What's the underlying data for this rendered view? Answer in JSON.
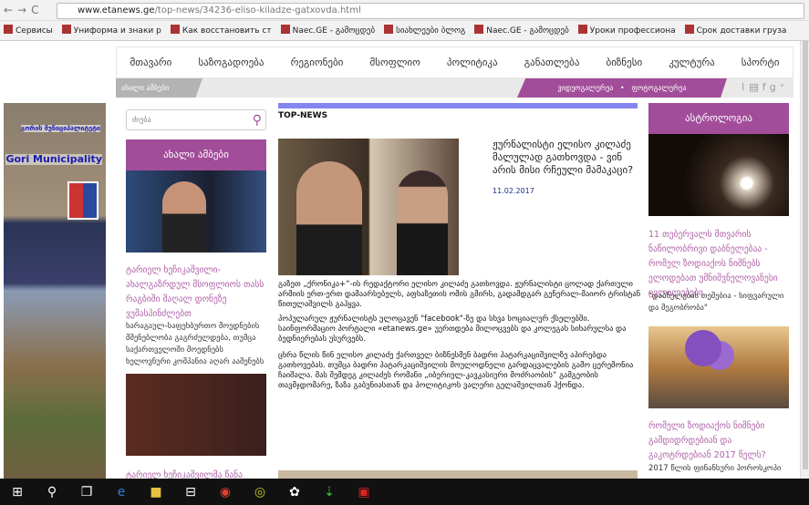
{
  "browser": {
    "url_domain": "www.etanews.ge",
    "url_path": "/top-news/34236-eliso-kiladze-gatxovda.html",
    "bookmarks": [
      "Сервисы",
      "Униформа и знаки р",
      "Как восстановить ст",
      "Naec.GE - გამოცდებ",
      "სიახლეები ბლოგ",
      "Naec.GE - გამოცდებ",
      "Уроки профессиона",
      "Срок доставки груза"
    ]
  },
  "nav": {
    "items": [
      "მთავარი",
      "საზოგადოება",
      "რეგიონები",
      "მსოფლიო",
      "პოლიტიკა",
      "განათლება",
      "ბიზნესი",
      "კულტურა",
      "სპორტი"
    ]
  },
  "subnav": {
    "latest": "ახალი ამბები",
    "video": "ვიდეოგალერეა",
    "dot": "•",
    "photo": "ფოტოგალერეა"
  },
  "banner": {
    "ka": "გორის მუნიციპალიტეტი",
    "en": "Gori Municipality"
  },
  "search": {
    "placeholder": "ძიება"
  },
  "left": {
    "heading": "ახალი ამბები",
    "item1_title": "ტარიელ ხეჩიკაშვილი- ახალგაზრდულ მსოფლიოს თასს რაგბიში მაღალ დონეზე ვუმასპინძლებთ",
    "item1_text": "ხარაგაულ-საფეხბურთო მოედნების მშენებლობა გაგრძელდება, თუმცა საქართველოში მოედნებს ხელოვნური კომპანია აღარ ააშენებს",
    "item2_title": "ტარიელ ხეჩიკაშვილმა წანა"
  },
  "main": {
    "section": "TOP-NEWS",
    "headline": "ჟურნალისტი ელისო კილაძე მალულად გათხოვდა - ვინ არის მისი რჩეული მამაკაცი?",
    "date": "11.02.2017",
    "p1": "გაზეთ „ქრონიკა+“-ის რედაქტორი ელისო კილაძე გათხოვდა. ჟურნალისტი ცოლად ქართული არმიის ერთ-ერთ დამაარსებელს, აფხაზეთის ომის გმირს, გადამდგარ გენერალ-მაიორ ტრისტან წითელაშვილს გაჰყვა.",
    "p2": "პოპულარულ ჟურნალისტს ულოცავენ \"facebook\"-ზე და სხვა სოციალურ ქსელებში. საინფორმაციო პორტალი «etanews.ge» უერთდება მილოცვებს და კოლეგას სიხარულსა და ბედნიერებას უსურვებს.",
    "p3": "ცხრა წლის წინ ელისო კილაძე ქართველ ბიზნესმენ ბადრი პატარკაციშვილზე აპირებდა გათხოვებას. თუმცა ბადრი პატარკაციშვილის მოულოდნელი გარდაცვალების გამო ცერემონია ჩაიშალა. მას შემდეგ კილაძეს რომანი „იბერიულ-კავკასიური მოძრაობის“ გამგეობის თავმჯდომარე, ზაზა გაბუნიასთან და პოლიტიკოს ვალერი გელაშვილთან ჰქონდა."
  },
  "right": {
    "heading": "ასტროლოგია",
    "item1_title": "11 თებერვალს მთვარის ნაწილობრივი დაბნელებაა - რომელ ზოდიაქოს ნიშნებს ელოდებათ უმნიშვნელოვანესი ცვლილებები",
    "item1_text": "\"დაბნელების თემებია - ხიფვარული და მეგობრობა\"",
    "item2_title": "რომელი ზოდიაქოს ნიშნები გამდიდრდებიან და გაკოტრდებიან 2017 წელს?",
    "item2_text": "2017 წლის ფინანსური ჰოროსკოპი"
  },
  "colors": {
    "accent": "#a24d9a",
    "topbar": "#8585ef",
    "date": "#1b2f8a"
  }
}
